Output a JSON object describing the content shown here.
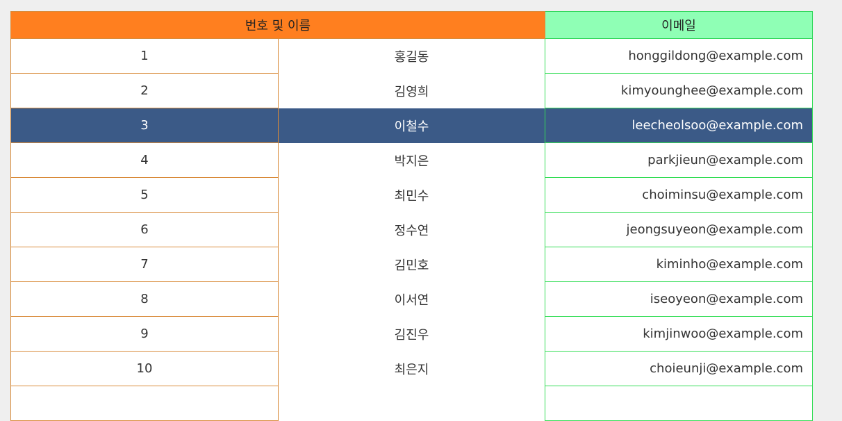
{
  "table": {
    "headers": {
      "group": "번호 및 이름",
      "email": "이메일"
    },
    "rows": [
      {
        "num": "1",
        "name": "홍길동",
        "email": "honggildong@example.com"
      },
      {
        "num": "2",
        "name": "김영희",
        "email": "kimyounghee@example.com"
      },
      {
        "num": "3",
        "name": "이철수",
        "email": "leecheolsoo@example.com",
        "selected": true
      },
      {
        "num": "4",
        "name": "박지은",
        "email": "parkjieun@example.com"
      },
      {
        "num": "5",
        "name": "최민수",
        "email": "choiminsu@example.com"
      },
      {
        "num": "6",
        "name": "정수연",
        "email": "jeongsuyeon@example.com"
      },
      {
        "num": "7",
        "name": "김민호",
        "email": "kiminho@example.com"
      },
      {
        "num": "8",
        "name": "이서연",
        "email": "iseoyeon@example.com"
      },
      {
        "num": "9",
        "name": "김진우",
        "email": "kimjinwoo@example.com"
      },
      {
        "num": "10",
        "name": "최은지",
        "email": "choieunji@example.com"
      },
      {
        "num": "",
        "name": "",
        "email": ""
      }
    ],
    "colors": {
      "group_header_bg": "#ff7f1f",
      "email_header_bg": "#8fffb5",
      "selected_row_bg": "#3b5a87",
      "orange_border": "#d98b3a",
      "green_border": "#33dd55"
    }
  }
}
